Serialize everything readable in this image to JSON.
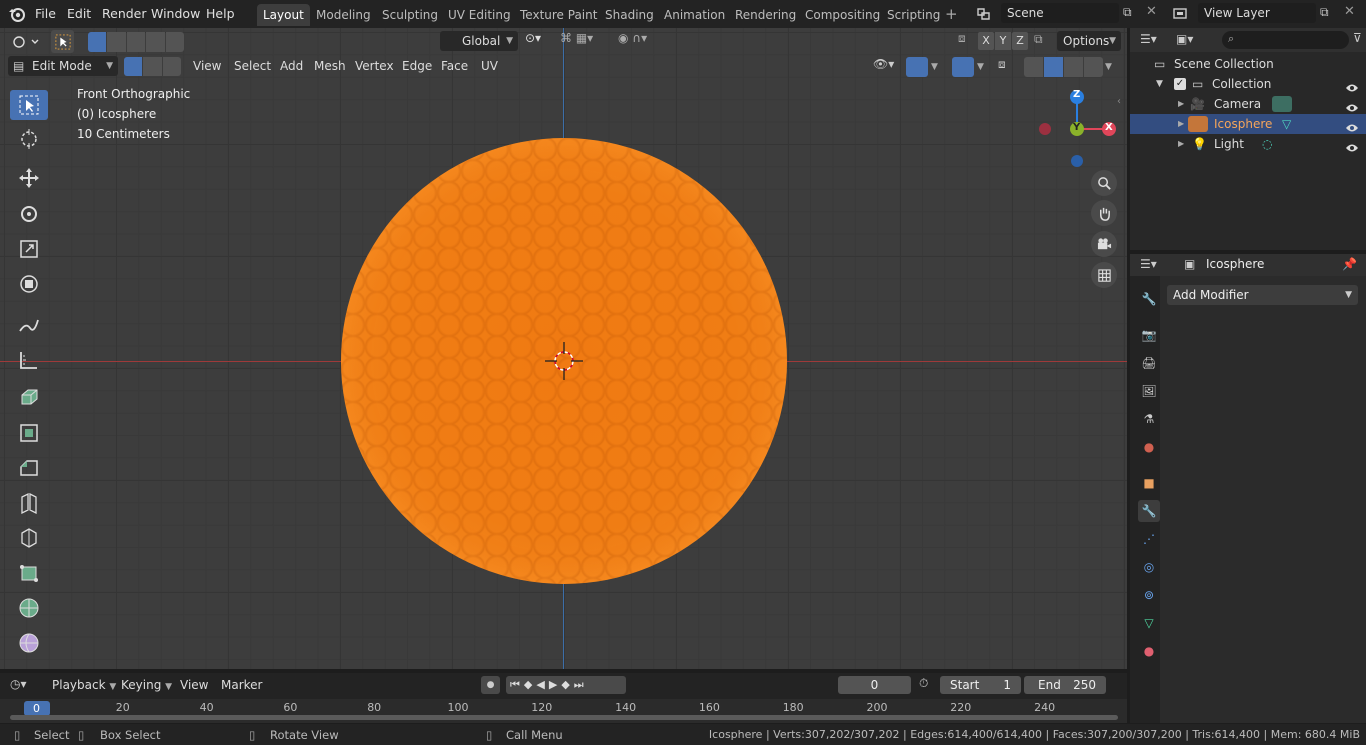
{
  "menu": {
    "file": "File",
    "edit": "Edit",
    "render": "Render",
    "window": "Window",
    "help": "Help"
  },
  "workspaces": [
    "Layout",
    "Modeling",
    "Sculpting",
    "UV Editing",
    "Texture Paint",
    "Shading",
    "Animation",
    "Rendering",
    "Compositing",
    "Scripting"
  ],
  "active_workspace": "Layout",
  "scene": {
    "name": "Scene",
    "view_layer": "View Layer"
  },
  "viewport": {
    "transform_orientation": "Global",
    "options": "Options",
    "mode": "Edit Mode",
    "header_menus": [
      "View",
      "Select",
      "Add",
      "Mesh",
      "Vertex",
      "Edge",
      "Face",
      "UV"
    ],
    "axis_x": "X",
    "axis_y": "Y",
    "axis_z": "Z",
    "info_view": "Front Orthographic",
    "info_object": "(0) Icosphere",
    "info_scale": "10 Centimeters",
    "gizmo": {
      "z": "Z",
      "y": "Y",
      "x": "X"
    }
  },
  "outliner": {
    "root": "Scene Collection",
    "collection": "Collection",
    "items": [
      {
        "name": "Camera",
        "selected": false
      },
      {
        "name": "Icosphere",
        "selected": true
      },
      {
        "name": "Light",
        "selected": false
      }
    ]
  },
  "properties": {
    "object_name": "Icosphere",
    "add_modifier": "Add Modifier"
  },
  "timeline": {
    "menus": [
      "Playback",
      "Keying",
      "View",
      "Marker"
    ],
    "current_frame": "0",
    "start_label": "Start",
    "start": "1",
    "end_label": "End",
    "end": "250",
    "ticks": [
      "0",
      "20",
      "40",
      "60",
      "80",
      "100",
      "120",
      "140",
      "160",
      "180",
      "200",
      "220",
      "240"
    ]
  },
  "status": {
    "select": "Select",
    "box_select": "Box Select",
    "rotate_view": "Rotate View",
    "call_menu": "Call Menu",
    "stats": "Icosphere | Verts:307,202/307,202 | Edges:614,400/614,400 | Faces:307,200/307,200 | Tris:614,400 | Mem: 680.4 MiB"
  },
  "colors": {
    "accent": "#4772b3",
    "mesh": "#f07d14",
    "x_axis": "#e0465a",
    "y_axis": "#8ab22a",
    "z_axis": "#2a7fe0"
  }
}
